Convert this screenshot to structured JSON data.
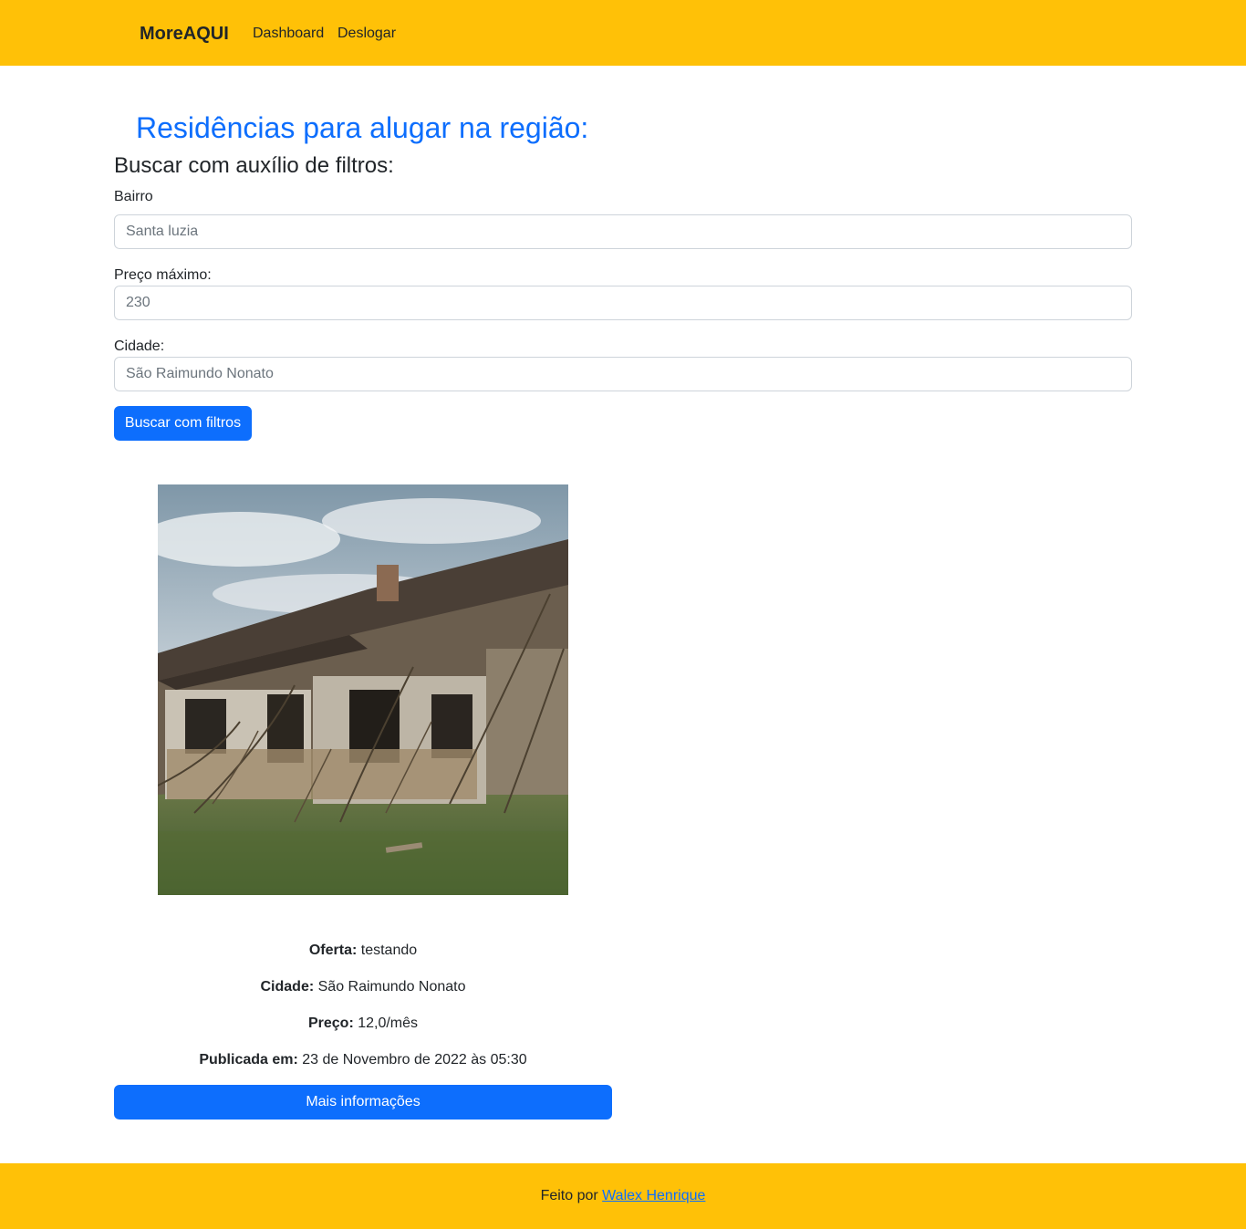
{
  "navbar": {
    "brand": "MoreAQUI",
    "links": [
      "Dashboard",
      "Deslogar"
    ]
  },
  "page": {
    "title": "Residências para alugar na região:",
    "filter_title": "Buscar com auxílio de filtros:"
  },
  "filters": {
    "bairro_label": "Bairro",
    "bairro_placeholder": "Santa luzia",
    "preco_label": "Preço máximo:",
    "preco_placeholder": "230",
    "cidade_label": "Cidade:",
    "cidade_placeholder": "São Raimundo Nonato",
    "submit_label": "Buscar com filtros"
  },
  "listing": {
    "oferta_label": "Oferta:",
    "oferta_value": " testando",
    "cidade_label": "Cidade:",
    "cidade_value": " São Raimundo Nonato",
    "preco_label": "Preço:",
    "preco_value": " 12,0/mês",
    "publicada_label": "Publicada em:",
    "publicada_value": " 23 de Novembro de 2022 às 05:30",
    "more_button": "Mais informações"
  },
  "footer": {
    "text": "Feito por ",
    "author": "Walex Henrique"
  },
  "colors": {
    "navbar_bg": "#ffc107",
    "primary": "#0d6efd",
    "text": "#212529"
  }
}
